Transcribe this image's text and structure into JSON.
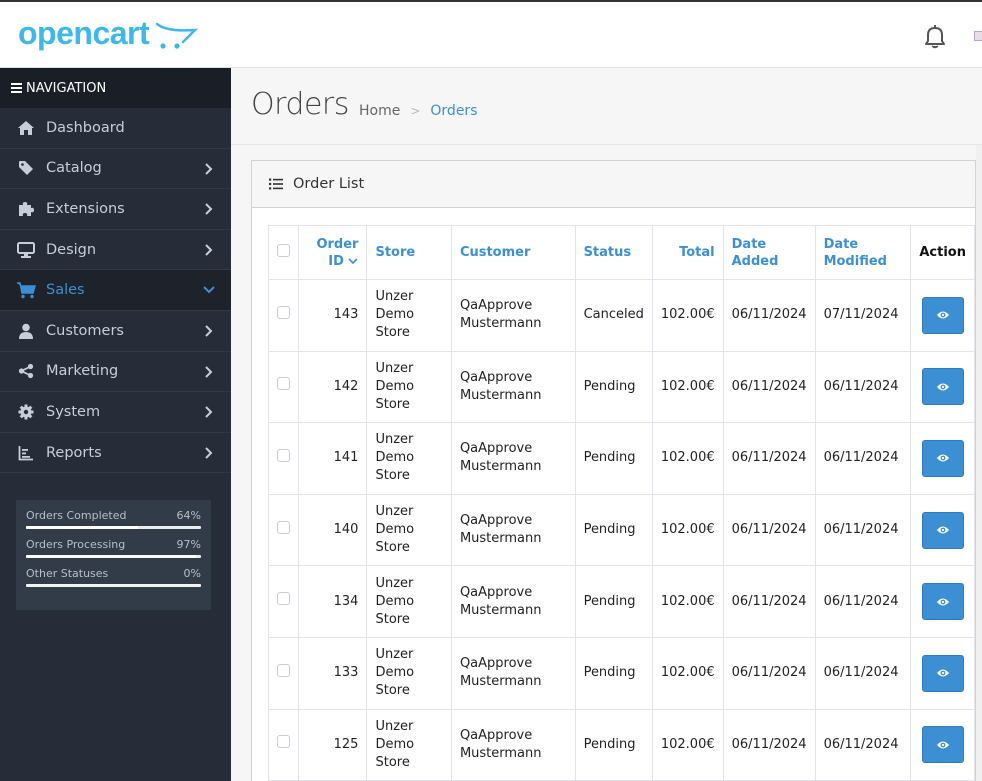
{
  "header": {
    "logo_text": "opencart",
    "notifications_icon": "bell-icon",
    "language_icon": "flag-icon"
  },
  "sidebar": {
    "title": "NAVIGATION",
    "items": [
      {
        "label": "Dashboard",
        "icon": "home-icon",
        "has_children": false,
        "active": false
      },
      {
        "label": "Catalog",
        "icon": "tag-icon",
        "has_children": true,
        "active": false
      },
      {
        "label": "Extensions",
        "icon": "puzzle-icon",
        "has_children": true,
        "active": false
      },
      {
        "label": "Design",
        "icon": "monitor-icon",
        "has_children": true,
        "active": false
      },
      {
        "label": "Sales",
        "icon": "cart-icon",
        "has_children": true,
        "active": true
      },
      {
        "label": "Customers",
        "icon": "user-icon",
        "has_children": true,
        "active": false
      },
      {
        "label": "Marketing",
        "icon": "share-icon",
        "has_children": true,
        "active": false
      },
      {
        "label": "System",
        "icon": "gear-icon",
        "has_children": true,
        "active": false
      },
      {
        "label": "Reports",
        "icon": "bar-chart-icon",
        "has_children": true,
        "active": false
      }
    ],
    "stats": [
      {
        "label": "Orders Completed",
        "value": "64%",
        "percent": 64
      },
      {
        "label": "Orders Processing",
        "value": "97%",
        "percent": 97
      },
      {
        "label": "Other Statuses",
        "value": "0%",
        "percent": 0
      }
    ]
  },
  "page": {
    "title": "Orders",
    "breadcrumb": [
      {
        "label": "Home"
      },
      {
        "label": "Orders"
      }
    ]
  },
  "panel": {
    "title": "Order List"
  },
  "table": {
    "headers": {
      "order_id": "Order ID",
      "order_id_line1": "Order",
      "order_id_line2": "ID",
      "store": "Store",
      "customer": "Customer",
      "status": "Status",
      "total": "Total",
      "date_added": "Date Added",
      "date_added_line1": "Date",
      "date_added_line2": "Added",
      "date_modified": "Date Modified",
      "date_modified_line1": "Date",
      "date_modified_line2": "Modified",
      "action": "Action"
    },
    "sort": {
      "column": "order_id",
      "direction": "desc"
    },
    "rows": [
      {
        "order_id": "143",
        "store": "Unzer Demo Store",
        "customer": "QaApprove Mustermann",
        "status": "Canceled",
        "total": "102.00€",
        "date_added": "06/11/2024",
        "date_modified": "07/11/2024"
      },
      {
        "order_id": "142",
        "store": "Unzer Demo Store",
        "customer": "QaApprove Mustermann",
        "status": "Pending",
        "total": "102.00€",
        "date_added": "06/11/2024",
        "date_modified": "06/11/2024"
      },
      {
        "order_id": "141",
        "store": "Unzer Demo Store",
        "customer": "QaApprove Mustermann",
        "status": "Pending",
        "total": "102.00€",
        "date_added": "06/11/2024",
        "date_modified": "06/11/2024"
      },
      {
        "order_id": "140",
        "store": "Unzer Demo Store",
        "customer": "QaApprove Mustermann",
        "status": "Pending",
        "total": "102.00€",
        "date_added": "06/11/2024",
        "date_modified": "06/11/2024"
      },
      {
        "order_id": "134",
        "store": "Unzer Demo Store",
        "customer": "QaApprove Mustermann",
        "status": "Pending",
        "total": "102.00€",
        "date_added": "06/11/2024",
        "date_modified": "06/11/2024"
      },
      {
        "order_id": "133",
        "store": "Unzer Demo Store",
        "customer": "QaApprove Mustermann",
        "status": "Pending",
        "total": "102.00€",
        "date_added": "06/11/2024",
        "date_modified": "06/11/2024"
      },
      {
        "order_id": "125",
        "store": "Unzer Demo Store",
        "customer": "QaApprove Mustermann",
        "status": "Pending",
        "total": "102.00€",
        "date_added": "06/11/2024",
        "date_modified": "06/11/2024"
      }
    ],
    "row_action": {
      "icon": "eye-icon",
      "label": "View"
    }
  },
  "colors": {
    "brand": "#3eb7ea",
    "accent": "#3d8fd4",
    "sidebar_bg": "#272d38",
    "sidebar_header_bg": "#1a1e27"
  }
}
